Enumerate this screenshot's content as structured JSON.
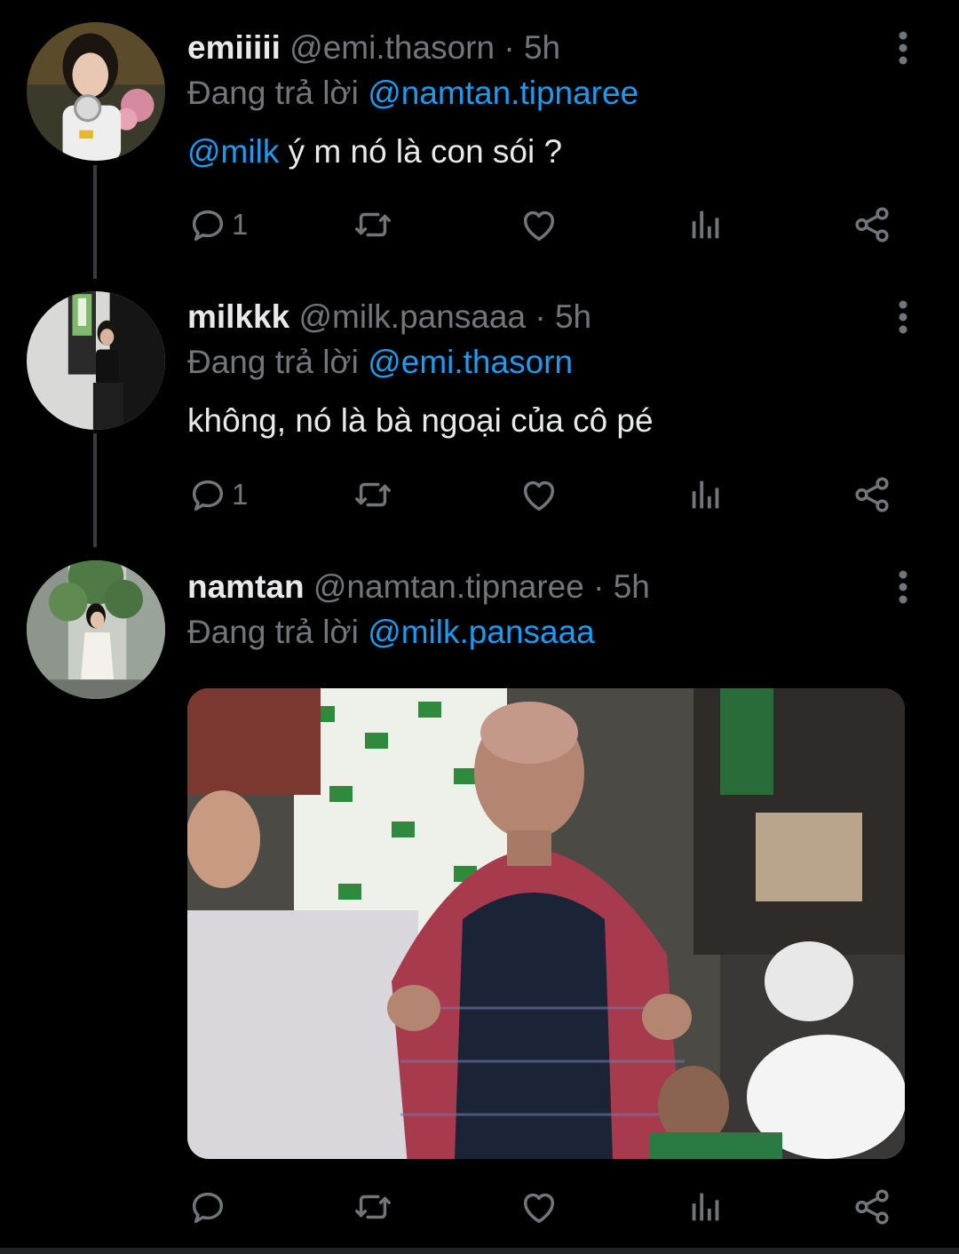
{
  "tweets": [
    {
      "name": "emiiiii",
      "handle": "@emi.thasorn",
      "separator": "·",
      "time": "5h",
      "replying_label": "Đang trả lời",
      "replying_to": "@namtan.tipnaree",
      "body_mention": "@milk",
      "body_text": " ý m nó là con sói ?",
      "reply_count": "1"
    },
    {
      "name": "milkkk",
      "handle": "@milk.pansaaa",
      "separator": "·",
      "time": "5h",
      "replying_label": "Đang trả lời",
      "replying_to": "@emi.thasorn",
      "body_text": "không, nó là bà ngoại của cô pé",
      "reply_count": "1"
    },
    {
      "name": "namtan",
      "handle": "@namtan.tipnaree",
      "separator": "·",
      "time": "5h",
      "replying_label": "Đang trả lời",
      "replying_to": "@milk.pansaaa",
      "reply_count": ""
    }
  ],
  "icons": {
    "reply": "reply-icon",
    "retweet": "retweet-icon",
    "like": "like-icon",
    "views": "views-icon",
    "share": "share-icon",
    "more": "more-vertical-icon"
  },
  "colors": {
    "background": "#000000",
    "text": "#e7e9ea",
    "muted": "#71767b",
    "mention": "#1d9bf0"
  }
}
